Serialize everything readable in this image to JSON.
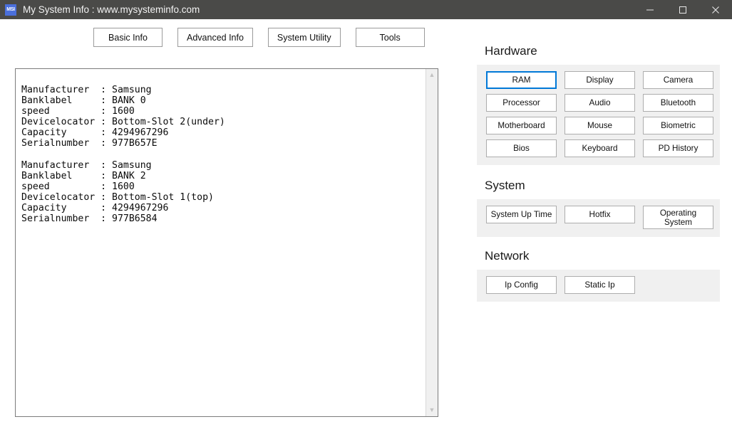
{
  "window": {
    "icon_label": "MSI",
    "icon_name": "app-icon",
    "title": "My System Info : www.mysysteminfo.com",
    "controls": [
      {
        "name": "minimize-button",
        "label": "—"
      },
      {
        "name": "maximize-button",
        "label": "☐"
      },
      {
        "name": "close-button",
        "label": "✕"
      }
    ]
  },
  "topnav": {
    "buttons": [
      {
        "label": "Basic Info",
        "name": "tab-basic-info"
      },
      {
        "label": "Advanced Info",
        "name": "tab-advanced-info"
      },
      {
        "label": "System Utility",
        "name": "tab-system-utility"
      },
      {
        "label": "Tools",
        "name": "tab-tools"
      }
    ]
  },
  "output": {
    "text": "Manufacturer  : Samsung\nBanklabel     : BANK 0\nspeed         : 1600\nDevicelocator : Bottom-Slot 2(under)\nCapacity      : 4294967296\nSerialnumber  : 977B657E\n\nManufacturer  : Samsung\nBanklabel     : BANK 2\nspeed         : 1600\nDevicelocator : Bottom-Slot 1(top)\nCapacity      : 4294967296\nSerialnumber  : 977B6584",
    "records": [
      {
        "Manufacturer": "Samsung",
        "Banklabel": "BANK 0",
        "speed": "1600",
        "Devicelocator": "Bottom-Slot 2(under)",
        "Capacity": "4294967296",
        "Serialnumber": "977B657E"
      },
      {
        "Manufacturer": "Samsung",
        "Banklabel": "BANK 2",
        "speed": "1600",
        "Devicelocator": "Bottom-Slot 1(top)",
        "Capacity": "4294967296",
        "Serialnumber": "977B6584"
      }
    ],
    "scrollbar": {
      "up_arrow": "▲",
      "down_arrow": "▼"
    }
  },
  "sections": [
    {
      "title": "Hardware",
      "name": "section-hardware",
      "buttons": [
        {
          "label": "RAM",
          "name": "button-ram",
          "focused": true
        },
        {
          "label": "Display",
          "name": "button-display",
          "focused": false
        },
        {
          "label": "Camera",
          "name": "button-camera",
          "focused": false
        },
        {
          "label": "Processor",
          "name": "button-processor",
          "focused": false
        },
        {
          "label": "Audio",
          "name": "button-audio",
          "focused": false
        },
        {
          "label": "Bluetooth",
          "name": "button-bluetooth",
          "focused": false
        },
        {
          "label": "Motherboard",
          "name": "button-motherboard",
          "focused": false
        },
        {
          "label": "Mouse",
          "name": "button-mouse",
          "focused": false
        },
        {
          "label": "Biometric",
          "name": "button-biometric",
          "focused": false
        },
        {
          "label": "Bios",
          "name": "button-bios",
          "focused": false
        },
        {
          "label": "Keyboard",
          "name": "button-keyboard",
          "focused": false
        },
        {
          "label": "PD History",
          "name": "button-pd-history",
          "focused": false
        }
      ]
    },
    {
      "title": "System",
      "name": "section-system",
      "buttons": [
        {
          "label": "System Up Time",
          "name": "button-system-up-time",
          "focused": false
        },
        {
          "label": "Hotfix",
          "name": "button-hotfix",
          "focused": false
        },
        {
          "label": "Operating\nSystem",
          "name": "button-operating-system",
          "focused": false,
          "two_line": true
        }
      ]
    },
    {
      "title": "Network",
      "name": "section-network",
      "buttons": [
        {
          "label": "Ip Config",
          "name": "button-ip-config",
          "focused": false
        },
        {
          "label": "Static Ip",
          "name": "button-static-ip",
          "focused": false
        }
      ]
    }
  ],
  "colors": {
    "titlebar_bg": "#4a4a48",
    "panel_bg": "#f0f0f0",
    "focus_border": "#0078d7",
    "button_border": "#adadad",
    "text": "#111111"
  }
}
